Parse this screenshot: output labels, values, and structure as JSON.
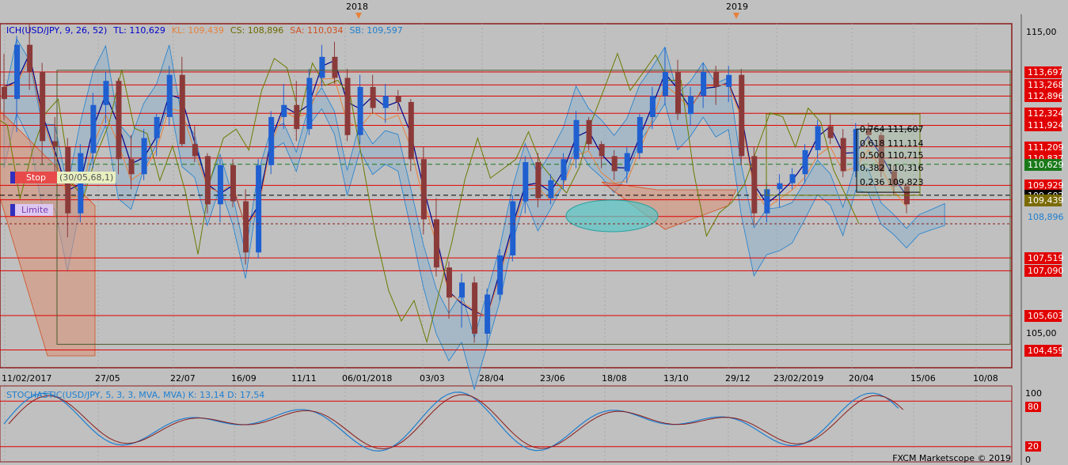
{
  "header": {
    "indicator": "ICH(USD/JPY, 9, 26, 52)",
    "tl": "TL: 110,629",
    "kl": "KL: 109,439",
    "cs": "CS: 108,896",
    "sa": "SA: 110,034",
    "sb": "SB: 109,597"
  },
  "orders": {
    "stop_label": "Stop",
    "stop_value": "(30/05,68,1)",
    "limit_label": "Limite"
  },
  "year_labels": [
    {
      "label": "2018",
      "date_index": 9
    },
    {
      "label": "2019",
      "date_index": 29
    }
  ],
  "date_labels": [
    "11/02/2017",
    "27/05",
    "22/07",
    "16/09",
    "11/11",
    "06/01/2018",
    "03/03",
    "28/04",
    "23/06",
    "18/08",
    "13/10",
    "29/12",
    "23/02/2019",
    "20/04",
    "15/06",
    "10/08"
  ],
  "price_ticks": [
    "115,00",
    "105,00"
  ],
  "price_tags": [
    {
      "label": "113,697",
      "color": "#e10000",
      "price": 113.697
    },
    {
      "label": "113,268",
      "color": "#e10000",
      "price": 113.268
    },
    {
      "label": "112,896",
      "color": "#e10000",
      "price": 112.896
    },
    {
      "label": "112,324",
      "color": "#e10000",
      "price": 112.324
    },
    {
      "label": "111,924",
      "color": "#e10000",
      "price": 111.924
    },
    {
      "label": "111,209",
      "color": "#e10000",
      "price": 111.209
    },
    {
      "label": "110,837",
      "color": "#e10000",
      "price": 110.837
    },
    {
      "label": "110,629",
      "color": "#1a7a1a",
      "price": 110.629
    },
    {
      "label": "109,929",
      "color": "#e10000",
      "price": 109.929
    },
    {
      "label": "109,602",
      "color": "#000000",
      "price": 109.602
    },
    {
      "label": "109,439",
      "color": "#7a6a00",
      "price": 109.45
    },
    {
      "label": "108,896",
      "color": "#1e7fd0",
      "price": 108.896
    },
    {
      "label": "107,519",
      "color": "#e10000",
      "price": 107.519
    },
    {
      "label": "107,090",
      "color": "#e10000",
      "price": 107.09
    },
    {
      "label": "105,603",
      "color": "#e10000",
      "price": 105.603
    },
    {
      "label": "104,459",
      "color": "#e10000",
      "price": 104.459
    }
  ],
  "fib_levels": [
    {
      "label": "0,764 111,607",
      "price": 111.607
    },
    {
      "label": "0,618 111,114",
      "price": 111.114
    },
    {
      "label": "0,500 110,715",
      "price": 110.715
    },
    {
      "label": "0,382 110,316",
      "price": 110.316
    },
    {
      "label": "0,236 109,823",
      "price": 109.823
    }
  ],
  "stochastic": {
    "header": "STOCHASTIC(USD/JPY, 5, 3, 3, MVA, MVA)  K: 13,14  D: 17,54",
    "ticks": [
      "100",
      "80",
      "20",
      "0"
    ]
  },
  "footer": "FXCM Marketscope © 2019",
  "chart_data": {
    "type": "candlestick",
    "title": "",
    "symbol": "USD/JPY",
    "timeframe": "weekly",
    "ylim": [
      104.0,
      115.3
    ],
    "horizontal_levels": [
      113.697,
      113.268,
      112.896,
      112.324,
      111.924,
      111.209,
      110.837,
      109.929,
      107.519,
      107.09,
      105.603,
      104.459
    ],
    "candles": [
      [
        113.2,
        114.3,
        112.1,
        112.8
      ],
      [
        112.8,
        114.9,
        111.7,
        114.6
      ],
      [
        114.6,
        115.3,
        113.1,
        113.7
      ],
      [
        113.7,
        114.0,
        110.6,
        111.4
      ],
      [
        111.4,
        112.2,
        110.1,
        111.2
      ],
      [
        111.2,
        111.5,
        108.2,
        109.0
      ],
      [
        109.0,
        111.3,
        108.7,
        111.0
      ],
      [
        111.0,
        113.0,
        110.5,
        112.6
      ],
      [
        112.6,
        113.7,
        112.0,
        113.4
      ],
      [
        113.4,
        113.5,
        110.3,
        110.8
      ],
      [
        110.8,
        111.6,
        109.8,
        110.3
      ],
      [
        110.3,
        111.8,
        110.1,
        111.5
      ],
      [
        111.5,
        112.3,
        110.9,
        112.2
      ],
      [
        112.2,
        113.9,
        111.9,
        113.6
      ],
      [
        113.6,
        114.2,
        111.2,
        111.3
      ],
      [
        111.3,
        111.9,
        110.7,
        110.9
      ],
      [
        110.9,
        111.0,
        109.0,
        109.3
      ],
      [
        109.3,
        110.8,
        108.7,
        110.6
      ],
      [
        110.6,
        110.8,
        109.2,
        109.4
      ],
      [
        109.4,
        109.8,
        107.3,
        107.7
      ],
      [
        107.7,
        110.8,
        107.5,
        110.6
      ],
      [
        110.6,
        112.4,
        110.3,
        112.2
      ],
      [
        112.2,
        113.3,
        111.8,
        112.6
      ],
      [
        112.6,
        113.4,
        111.4,
        111.8
      ],
      [
        111.8,
        113.8,
        111.6,
        113.5
      ],
      [
        113.5,
        114.6,
        113.2,
        114.2
      ],
      [
        114.2,
        114.7,
        113.3,
        113.5
      ],
      [
        113.5,
        113.8,
        111.4,
        111.6
      ],
      [
        111.6,
        113.6,
        111.3,
        113.2
      ],
      [
        113.2,
        113.6,
        112.3,
        112.5
      ],
      [
        112.5,
        113.3,
        112.0,
        112.9
      ],
      [
        112.9,
        113.1,
        112.4,
        112.7
      ],
      [
        112.7,
        112.8,
        110.4,
        110.8
      ],
      [
        110.8,
        111.2,
        108.3,
        108.8
      ],
      [
        108.8,
        109.5,
        106.9,
        107.2
      ],
      [
        107.2,
        107.4,
        105.5,
        106.2
      ],
      [
        106.2,
        107.0,
        105.2,
        106.7
      ],
      [
        106.7,
        106.9,
        104.7,
        105.0
      ],
      [
        105.0,
        106.5,
        104.6,
        106.3
      ],
      [
        106.3,
        107.8,
        106.1,
        107.6
      ],
      [
        107.6,
        109.6,
        107.4,
        109.4
      ],
      [
        109.4,
        110.9,
        109.0,
        110.7
      ],
      [
        110.7,
        111.0,
        109.2,
        109.5
      ],
      [
        109.5,
        110.3,
        109.3,
        110.1
      ],
      [
        110.1,
        111.0,
        109.8,
        110.8
      ],
      [
        110.8,
        112.4,
        110.5,
        112.1
      ],
      [
        112.1,
        112.2,
        111.1,
        111.3
      ],
      [
        111.3,
        111.4,
        110.5,
        110.9
      ],
      [
        110.9,
        111.1,
        110.1,
        110.4
      ],
      [
        110.4,
        111.2,
        110.0,
        111.0
      ],
      [
        111.0,
        112.3,
        110.8,
        112.2
      ],
      [
        112.2,
        113.2,
        111.8,
        112.9
      ],
      [
        112.9,
        114.5,
        112.6,
        113.7
      ],
      [
        113.7,
        114.1,
        112.1,
        112.3
      ],
      [
        112.3,
        113.2,
        111.9,
        112.9
      ],
      [
        112.9,
        114.0,
        112.5,
        113.7
      ],
      [
        113.7,
        113.9,
        112.6,
        113.2
      ],
      [
        113.2,
        113.9,
        112.7,
        113.6
      ],
      [
        113.6,
        113.8,
        110.6,
        110.9
      ],
      [
        110.9,
        111.2,
        108.6,
        109.0
      ],
      [
        109.0,
        110.0,
        108.7,
        109.8
      ],
      [
        109.8,
        110.3,
        109.2,
        110.0
      ],
      [
        110.0,
        110.5,
        109.8,
        110.3
      ],
      [
        110.3,
        111.3,
        110.0,
        111.1
      ],
      [
        111.1,
        112.1,
        110.8,
        111.9
      ],
      [
        111.9,
        112.3,
        111.3,
        111.5
      ],
      [
        111.5,
        111.8,
        110.2,
        110.4
      ],
      [
        110.4,
        112.0,
        110.2,
        111.8
      ],
      [
        111.8,
        112.0,
        111.3,
        111.6
      ],
      [
        111.6,
        111.7,
        110.2,
        110.4
      ],
      [
        110.4,
        110.6,
        109.6,
        109.9
      ],
      [
        109.9,
        110.0,
        109.0,
        109.3
      ]
    ],
    "ichimoku_lines": [
      "tenkan (TL)",
      "kijun (KL)",
      "chikou (CS)",
      "senkou A (SA)",
      "senkou B (SB)"
    ],
    "stochastic_levels": [
      80,
      20
    ]
  }
}
